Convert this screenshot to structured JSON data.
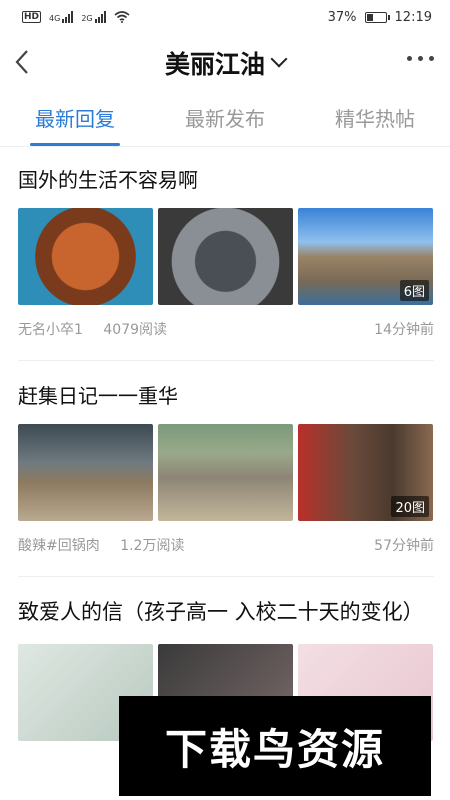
{
  "status": {
    "left_icons": [
      "hd-icon",
      "signal-4g-icon",
      "signal-2g-icon",
      "wifi-icon"
    ],
    "label_4g": "4G",
    "label_2g": "2G",
    "label_hd": "HD",
    "battery": "37%",
    "battery_level": 0.37,
    "time": "12:19"
  },
  "header": {
    "title": "美丽江油",
    "back_icon": "chevron-left-icon",
    "dropdown_icon": "chevron-down-icon",
    "more_icon": "more-dots-icon"
  },
  "tabs": [
    {
      "label": "最新回复",
      "active": true
    },
    {
      "label": "最新发布",
      "active": false
    },
    {
      "label": "精华热帖",
      "active": false
    }
  ],
  "posts": [
    {
      "title": "国外的生活不容易啊",
      "image_count": "6图",
      "author": "无名小卒1",
      "reads": "4079阅读",
      "time": "14分钟前"
    },
    {
      "title": "赶集日记一一重华",
      "image_count": "20图",
      "author": "酸辣#回锅肉",
      "reads": "1.2万阅读",
      "time": "57分钟前"
    },
    {
      "title": "致爱人的信（孩子高一 入校二十天的变化）",
      "image_count": "",
      "author": "",
      "reads": "",
      "time": ""
    }
  ],
  "watermark": "下载鸟资源",
  "colors": {
    "accent": "#2c7bd6",
    "muted": "#999999"
  }
}
